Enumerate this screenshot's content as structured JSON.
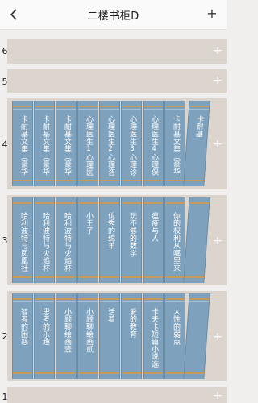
{
  "header": {
    "back_icon": "chevron-left-icon",
    "title": "二楼书柜D",
    "add_label": "+"
  },
  "shelves": [
    {
      "level": "6",
      "books": []
    },
    {
      "level": "5",
      "books": []
    },
    {
      "level": "4",
      "books": [
        "卡耐基文集（豪华",
        "卡耐基文集（豪华",
        "卡耐基文集（豪华",
        "心理医生1心理医",
        "心理医生2心理咨",
        "心理医生3心理诊",
        "心理医生4心理保",
        "卡耐基文集（豪华",
        "卡耐基"
      ]
    },
    {
      "level": "3",
      "books": [
        "哈利波特与凤凰社",
        "哈利波特与火焰杯",
        "哈利波特与火焰杯",
        "小王子",
        "优秀的绵羊",
        "玩不够的数学",
        "瘟疫与人",
        "你的权利从哪里来",
        ""
      ]
    },
    {
      "level": "2",
      "books": [
        "智者的困惑",
        "思考的乐趣",
        "小顾聊绘画壹",
        "小顾聊绘画贰",
        "活着",
        "爱的教育",
        "卡夫卡短篇小说选",
        "人性的弱点",
        ""
      ]
    },
    {
      "level": "1",
      "books": []
    }
  ],
  "plus_label": "+"
}
